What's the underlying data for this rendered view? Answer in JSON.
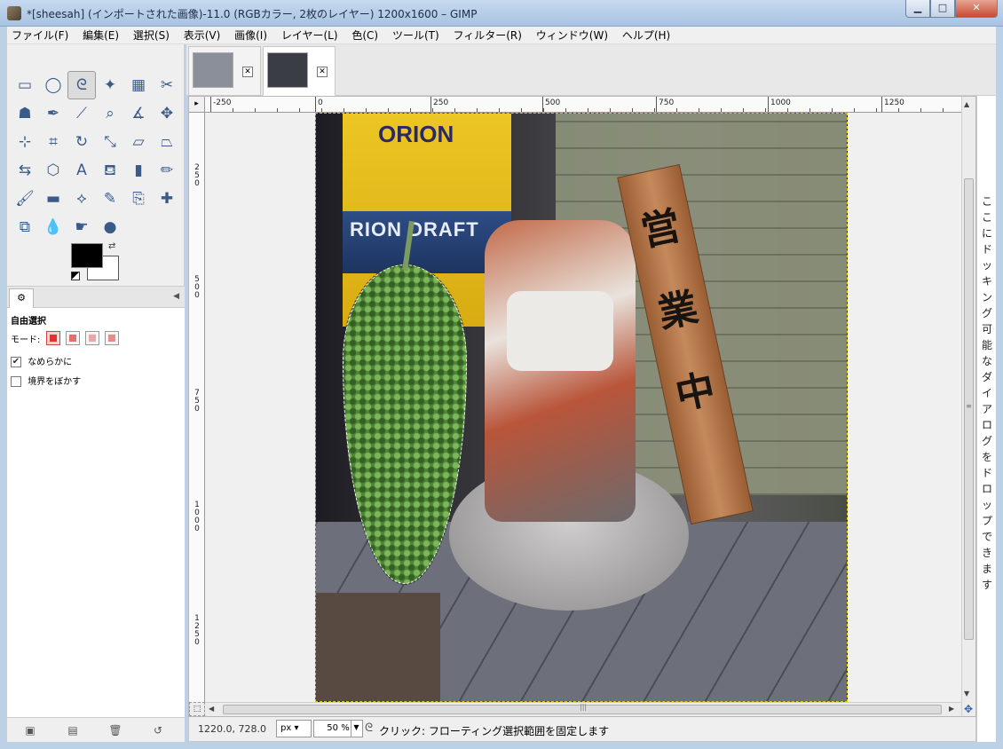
{
  "window": {
    "title": "*[sheesah] (インポートされた画像)-11.0 (RGBカラー, 2枚のレイヤー) 1200x1600 – GIMP",
    "min_label": "▁",
    "max_label": "□",
    "close_label": "✕"
  },
  "menu": [
    "ファイル(F)",
    "編集(E)",
    "選択(S)",
    "表示(V)",
    "画像(I)",
    "レイヤー(L)",
    "色(C)",
    "ツール(T)",
    "フィルター(R)",
    "ウィンドウ(W)",
    "ヘルプ(H)"
  ],
  "toolbox": {
    "tools": [
      {
        "name": "rect-select-icon",
        "glyph": "▭"
      },
      {
        "name": "ellipse-select-icon",
        "glyph": "◯"
      },
      {
        "name": "free-select-icon",
        "glyph": "ᘓ",
        "active": true
      },
      {
        "name": "fuzzy-select-icon",
        "glyph": "✦"
      },
      {
        "name": "select-by-color-icon",
        "glyph": "▦"
      },
      {
        "name": "scissors-select-icon",
        "glyph": "✂"
      },
      {
        "name": "foreground-select-icon",
        "glyph": "☗"
      },
      {
        "name": "paths-icon",
        "glyph": "✒"
      },
      {
        "name": "color-picker-icon",
        "glyph": "⟋"
      },
      {
        "name": "zoom-icon",
        "glyph": "⌕"
      },
      {
        "name": "measure-icon",
        "glyph": "∡"
      },
      {
        "name": "move-icon",
        "glyph": "✥"
      },
      {
        "name": "align-icon",
        "glyph": "⊹"
      },
      {
        "name": "crop-icon",
        "glyph": "⌗"
      },
      {
        "name": "rotate-icon",
        "glyph": "↻"
      },
      {
        "name": "scale-icon",
        "glyph": "⤡"
      },
      {
        "name": "shear-icon",
        "glyph": "▱"
      },
      {
        "name": "perspective-icon",
        "glyph": "⏢"
      },
      {
        "name": "flip-icon",
        "glyph": "⇆"
      },
      {
        "name": "cage-transform-icon",
        "glyph": "⬡"
      },
      {
        "name": "text-icon",
        "glyph": "A"
      },
      {
        "name": "bucket-fill-icon",
        "glyph": "⛾"
      },
      {
        "name": "blend-icon",
        "glyph": "▮"
      },
      {
        "name": "pencil-icon",
        "glyph": "✏"
      },
      {
        "name": "paintbrush-icon",
        "glyph": "🖌"
      },
      {
        "name": "eraser-icon",
        "glyph": "▬"
      },
      {
        "name": "airbrush-icon",
        "glyph": "⟡"
      },
      {
        "name": "ink-icon",
        "glyph": "✎"
      },
      {
        "name": "clone-icon",
        "glyph": "⎘"
      },
      {
        "name": "heal-icon",
        "glyph": "✚"
      },
      {
        "name": "perspective-clone-icon",
        "glyph": "⧉"
      },
      {
        "name": "blur-icon",
        "glyph": "💧"
      },
      {
        "name": "smudge-icon",
        "glyph": "☛"
      },
      {
        "name": "dodge-burn-icon",
        "glyph": "●"
      }
    ],
    "fg_color": "#000000",
    "bg_color": "#ffffff"
  },
  "tool_options": {
    "title": "自由選択",
    "mode_label": "モード:",
    "checkboxes": [
      {
        "label": "なめらかに",
        "checked": true
      },
      {
        "label": "境界をぼかす",
        "checked": false
      }
    ]
  },
  "image_tabs": [
    {
      "name": "tab-image-1",
      "thumb_color": "#8a8f9a"
    },
    {
      "name": "tab-image-2",
      "thumb_color": "#3a3d44",
      "active": true
    }
  ],
  "rulers": {
    "h_ticks": [
      "-250",
      "0",
      "250",
      "500",
      "750",
      "1000",
      "1250"
    ],
    "v_ticks": [
      "250",
      "500",
      "750",
      "1000",
      "1250"
    ]
  },
  "canvas": {
    "poster_top": "ORION",
    "poster_bottom": "RION DRAFT",
    "sign_chars": [
      "営",
      "業",
      "中"
    ]
  },
  "statusbar": {
    "coords": "1220.0, 728.0",
    "unit": "px",
    "zoom": "50 %",
    "message": "クリック: フローティング選択範囲を固定します"
  },
  "right_dock": {
    "hint": "ここにドッキング可能なダイアログをドロップできます"
  }
}
